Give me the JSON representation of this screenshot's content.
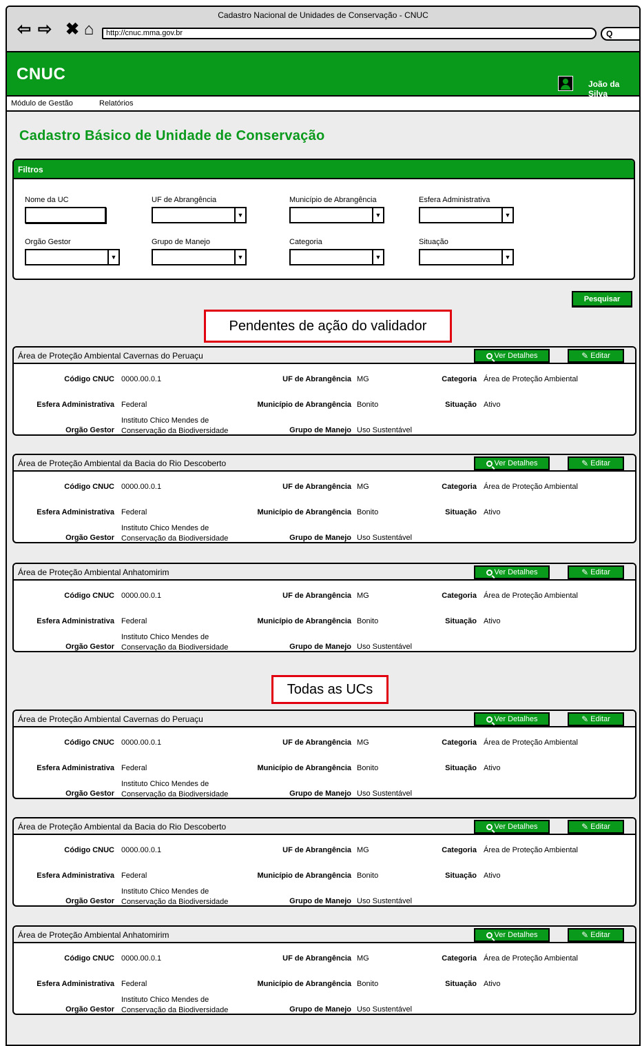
{
  "browser": {
    "window_title": "Cadastro Nacional de Unidades de Conservação - CNUC",
    "url": "http://cnuc.mma.gov.br",
    "icons": [
      "back-arrow-icon",
      "forward-arrow-icon",
      "close-icon",
      "home-icon",
      "search-icon"
    ]
  },
  "app": {
    "brand": "CNUC",
    "user_name": "João da Silva"
  },
  "menu": {
    "items": [
      "Módulo de Gestão",
      "Relatórios"
    ]
  },
  "page": {
    "title": "Cadastro Básico de Unidade de Conservação"
  },
  "filters": {
    "header": "Filtros",
    "labels": {
      "nome_uc": "Nome da UC",
      "uf": "UF de Abrangência",
      "municipio": "Município de Abrangência",
      "esfera": "Esfera Administrativa",
      "orgao": "Orgão Gestor",
      "grupo": "Grupo de Manejo",
      "categoria": "Categoria",
      "situacao": "Situação"
    },
    "search_button": "Pesquisar"
  },
  "field_labels": {
    "codigo": "Código CNUC",
    "uf": "UF de Abrangência",
    "categoria": "Categoria",
    "esfera": "Esfera Administrativa",
    "municipio": "Município de Abrangência",
    "situacao": "Situação",
    "orgao": "Orgão Gestor",
    "grupo": "Grupo de Manejo"
  },
  "buttons": {
    "details": "Ver Detalhes",
    "edit": "Editar"
  },
  "sections": [
    {
      "title": "Pendentes de ação do validador",
      "cards": [
        {
          "name": "Área de Proteção Ambiental Cavernas do Peruaçu",
          "codigo": "0000.00.0.1",
          "uf": "MG",
          "categoria": "Área de Proteção Ambiental",
          "esfera": "Federal",
          "municipio": "Bonito",
          "situacao": "Ativo",
          "orgao_line1": "Instituto Chico Mendes de",
          "orgao_line2": "Conservação da Biodiversidade",
          "grupo": "Uso Sustentável"
        },
        {
          "name": "Área de Proteção Ambiental da Bacia do Rio Descoberto",
          "codigo": "0000.00.0.1",
          "uf": "MG",
          "categoria": "Área de Proteção Ambiental",
          "esfera": "Federal",
          "municipio": "Bonito",
          "situacao": "Ativo",
          "orgao_line1": "Instituto Chico Mendes de",
          "orgao_line2": "Conservação da Biodiversidade",
          "grupo": "Uso Sustentável"
        },
        {
          "name": "Área de Proteção Ambiental Anhatomirim",
          "codigo": "0000.00.0.1",
          "uf": "MG",
          "categoria": "Área de Proteção Ambiental",
          "esfera": "Federal",
          "municipio": "Bonito",
          "situacao": "Ativo",
          "orgao_line1": "Instituto Chico Mendes de",
          "orgao_line2": "Conservação da Biodiversidade",
          "grupo": "Uso Sustentável"
        }
      ]
    },
    {
      "title": "Todas as UCs",
      "cards": [
        {
          "name": "Área de Proteção Ambiental Cavernas do Peruaçu",
          "codigo": "0000.00.0.1",
          "uf": "MG",
          "categoria": "Área de Proteção Ambiental",
          "esfera": "Federal",
          "municipio": "Bonito",
          "situacao": "Ativo",
          "orgao_line1": "Instituto Chico Mendes de",
          "orgao_line2": "Conservação da Biodiversidade",
          "grupo": "Uso Sustentável"
        },
        {
          "name": "Área de Proteção Ambiental da Bacia do Rio Descoberto",
          "codigo": "0000.00.0.1",
          "uf": "MG",
          "categoria": "Área de Proteção Ambiental",
          "esfera": "Federal",
          "municipio": "Bonito",
          "situacao": "Ativo",
          "orgao_line1": "Instituto Chico Mendes de",
          "orgao_line2": "Conservação da Biodiversidade",
          "grupo": "Uso Sustentável"
        },
        {
          "name": "Área de Proteção Ambiental Anhatomirim",
          "codigo": "0000.00.0.1",
          "uf": "MG",
          "categoria": "Área de Proteção Ambiental",
          "esfera": "Federal",
          "municipio": "Bonito",
          "situacao": "Ativo",
          "orgao_line1": "Instituto Chico Mendes de",
          "orgao_line2": "Conservação da Biodiversidade",
          "grupo": "Uso Sustentável"
        }
      ]
    }
  ]
}
